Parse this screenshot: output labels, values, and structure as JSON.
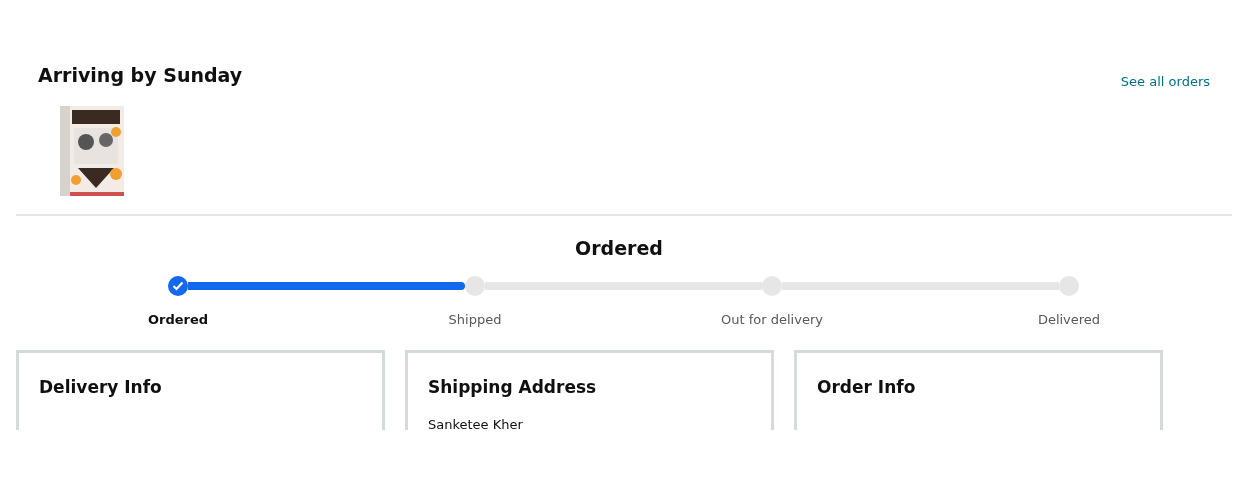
{
  "header": {
    "title": "Arriving by Sunday",
    "link": "See all orders"
  },
  "status": {
    "title": "Ordered",
    "steps": [
      {
        "label": "Ordered",
        "completed": true
      },
      {
        "label": "Shipped",
        "completed": false
      },
      {
        "label": "Out for delivery",
        "completed": false
      },
      {
        "label": "Delivered",
        "completed": false
      }
    ]
  },
  "cards": [
    {
      "title": "Delivery Info"
    },
    {
      "title": "Shipping Address",
      "lines": [
        "Sanketee Kher"
      ]
    },
    {
      "title": "Order Info"
    }
  ]
}
